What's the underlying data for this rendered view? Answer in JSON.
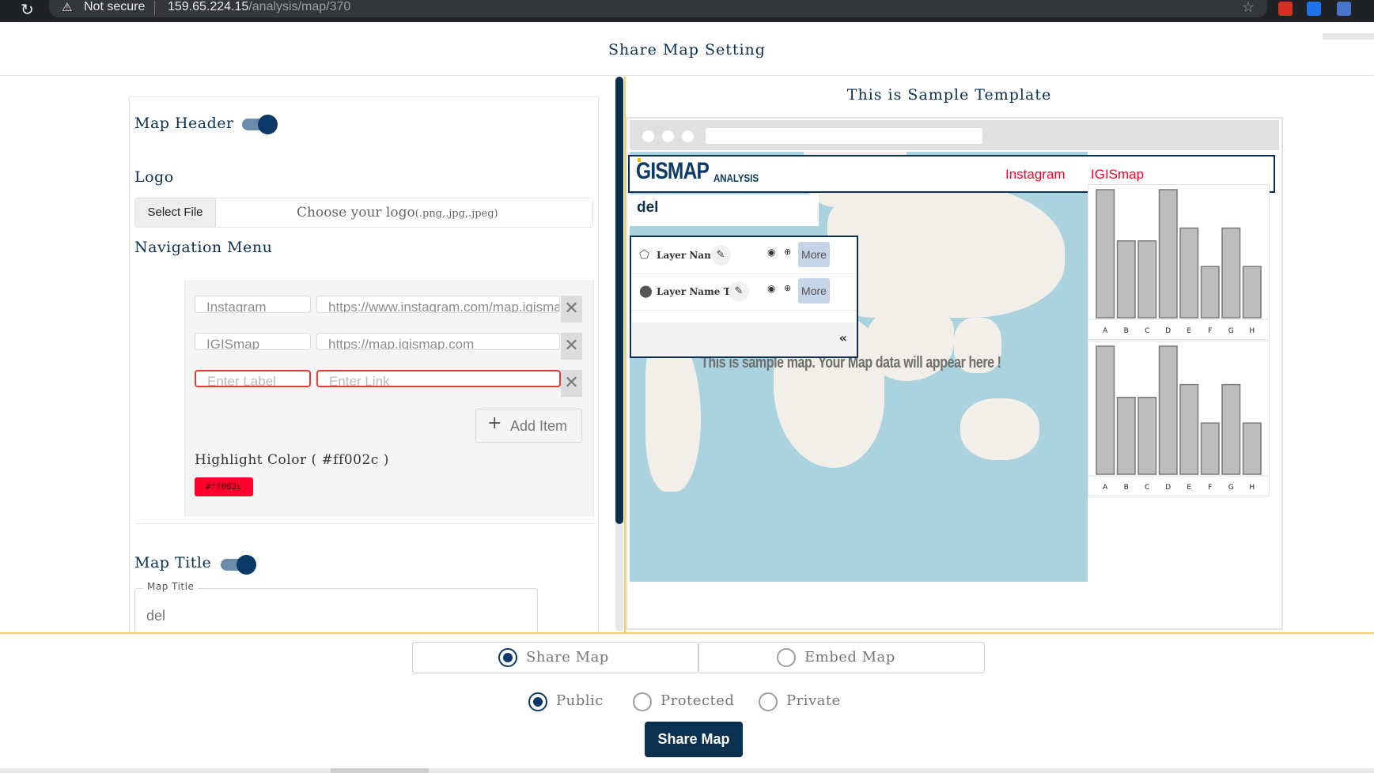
{
  "browser": {
    "security": "Not secure",
    "url_host": "159.65.224.15",
    "url_path": "/analysis/map/370"
  },
  "modal": {
    "title": "Share Map Setting"
  },
  "settings": {
    "map_header_label": "Map Header",
    "map_header_on": true,
    "logo_label": "Logo",
    "select_file": "Select File",
    "choose_logo": "Choose your logo",
    "logo_types": "(.png,.jpg,.jpeg)",
    "nav_menu_label": "Navigation Menu",
    "nav_items": [
      {
        "label": "Instagram",
        "link": "https://www.instagram.com/map.igismap/"
      },
      {
        "label": "IGISmap",
        "link": "https://map.igismap.com"
      }
    ],
    "new_item": {
      "label_placeholder": "Enter Label",
      "link_placeholder": "Enter Link"
    },
    "add_item": "Add Item",
    "highlight_label": "Highlight Color ( #ff002c )",
    "highlight_hex": "#ff002c",
    "map_title_label": "Map Title",
    "map_title_on": true,
    "map_title_field_label": "Map Title",
    "map_title_value": "del"
  },
  "preview": {
    "title": "This is Sample Template",
    "logo_main": "GISMAP",
    "logo_sub": "ANALYSIS",
    "nav_links": [
      "Instagram",
      "IGISmap"
    ],
    "map_title": "del",
    "layers": [
      {
        "name": "Layer Name",
        "icon": "polygon-icon",
        "more": "More"
      },
      {
        "name": "Layer Name T...",
        "icon": "pin-icon",
        "more": "More"
      }
    ],
    "collapse": "«",
    "sample_message": "This is sample map. Your Map data will appear here !"
  },
  "chart_data": [
    {
      "type": "bar",
      "categories": [
        "A",
        "B",
        "C",
        "D",
        "E",
        "F",
        "G",
        "H"
      ],
      "values": [
        10,
        6,
        6,
        10,
        7,
        4,
        7,
        4
      ],
      "ylim": [
        0,
        10
      ]
    },
    {
      "type": "bar",
      "categories": [
        "A",
        "B",
        "C",
        "D",
        "E",
        "F",
        "G",
        "H"
      ],
      "values": [
        10,
        6,
        6,
        10,
        7,
        4,
        7,
        4
      ],
      "ylim": [
        0,
        10
      ]
    }
  ],
  "share": {
    "tabs": [
      {
        "label": "Share Map",
        "selected": true
      },
      {
        "label": "Embed Map",
        "selected": false
      }
    ],
    "visibility": [
      {
        "label": "Public",
        "selected": true
      },
      {
        "label": "Protected",
        "selected": false
      },
      {
        "label": "Private",
        "selected": false
      }
    ],
    "button": "Share Map"
  },
  "colors": {
    "primary": "#0b3150",
    "highlight": "#ff002c",
    "accent_line": "#f3d35c"
  }
}
